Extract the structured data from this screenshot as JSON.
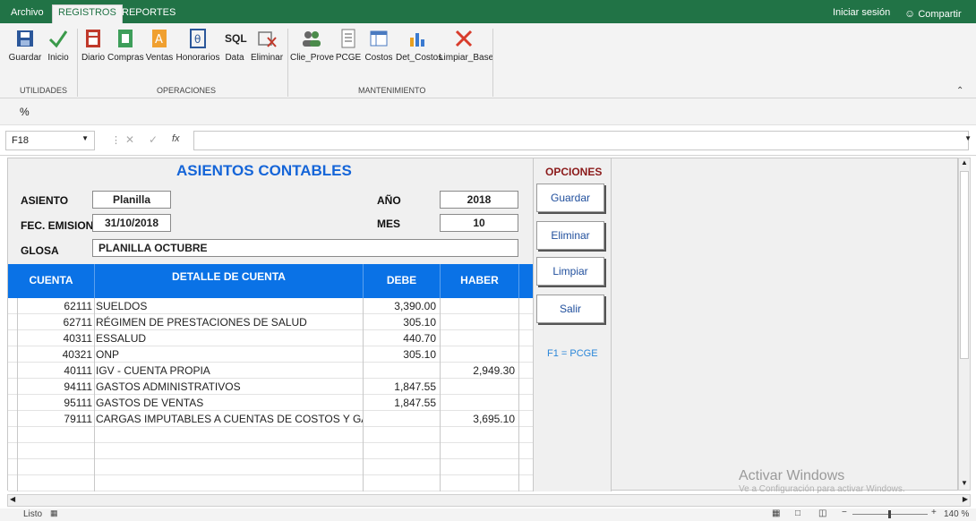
{
  "ribbon_tabs": {
    "archivo": "Archivo",
    "registros": "REGISTROS",
    "reportes": "REPORTES"
  },
  "titlebar_right": {
    "signin": "Iniciar sesión",
    "share": "Compartir"
  },
  "ribbon": {
    "groups": {
      "utilidades": "UTILIDADES",
      "operaciones": "OPERACIONES",
      "mantenimiento": "MANTENIMIENTO"
    },
    "buttons": {
      "guardar": "Guardar",
      "inicio": "Inicio",
      "diario": "Diario",
      "compras": "Compras",
      "ventas": "Ventas",
      "honorarios": "Honorarios",
      "data": "Data",
      "eliminar": "Eliminar",
      "clie_prove": "Clie_Prove",
      "pcge": "PCGE",
      "costos": "Costos",
      "det_costos": "Det_Costos",
      "limpiar_base": "Limpiar_Base"
    },
    "sql_label": "SQL",
    "percent": "%"
  },
  "formula_bar": {
    "name_box": "F18",
    "fx": "fx",
    "value": ""
  },
  "form": {
    "title": "ASIENTOS CONTABLES",
    "asiento_label": "ASIENTO",
    "asiento_value": "Planilla",
    "fec_label": "FEC. EMISION",
    "fec_value": "31/10/2018",
    "glosa_label": "GLOSA",
    "glosa_value": "PLANILLA  OCTUBRE",
    "anio_label": "AÑO",
    "anio_value": "2018",
    "mes_label": "MES",
    "mes_value": "10"
  },
  "table": {
    "headers": {
      "cuenta": "CUENTA",
      "detalle": "DETALLE DE CUENTA",
      "debe": "DEBE",
      "haber": "HABER"
    },
    "rows": [
      {
        "cuenta": "62111",
        "detalle": "SUELDOS",
        "debe": "3,390.00",
        "haber": ""
      },
      {
        "cuenta": "62711",
        "detalle": "RÉGIMEN DE PRESTACIONES DE SALUD",
        "debe": "305.10",
        "haber": ""
      },
      {
        "cuenta": "40311",
        "detalle": "ESSALUD",
        "debe": "440.70",
        "haber": ""
      },
      {
        "cuenta": "40321",
        "detalle": "ONP",
        "debe": "305.10",
        "haber": ""
      },
      {
        "cuenta": "40111",
        "detalle": "IGV - CUENTA PROPIA",
        "debe": "",
        "haber": "2,949.30"
      },
      {
        "cuenta": "94111",
        "detalle": "GASTOS ADMINISTRATIVOS",
        "debe": "1,847.55",
        "haber": ""
      },
      {
        "cuenta": "95111",
        "detalle": "GASTOS DE VENTAS",
        "debe": "1,847.55",
        "haber": ""
      },
      {
        "cuenta": "79111",
        "detalle": "CARGAS IMPUTABLES A CUENTAS DE COSTOS Y GASTOS",
        "debe": "",
        "haber": "3,695.10"
      }
    ]
  },
  "options": {
    "title": "OPCIONES",
    "guardar": "Guardar",
    "eliminar": "Eliminar",
    "limpiar": "Limpiar",
    "salir": "Salir",
    "hint": "F1 = PCGE"
  },
  "watermark": {
    "line1": "Activar Windows",
    "line2": "Ve a Configuración para activar Windows."
  },
  "status": {
    "ready": "Listo",
    "zoom": "140 %"
  },
  "colors": {
    "excel_green": "#217346",
    "header_blue": "#0a72e6",
    "title_blue": "#1565d8"
  }
}
